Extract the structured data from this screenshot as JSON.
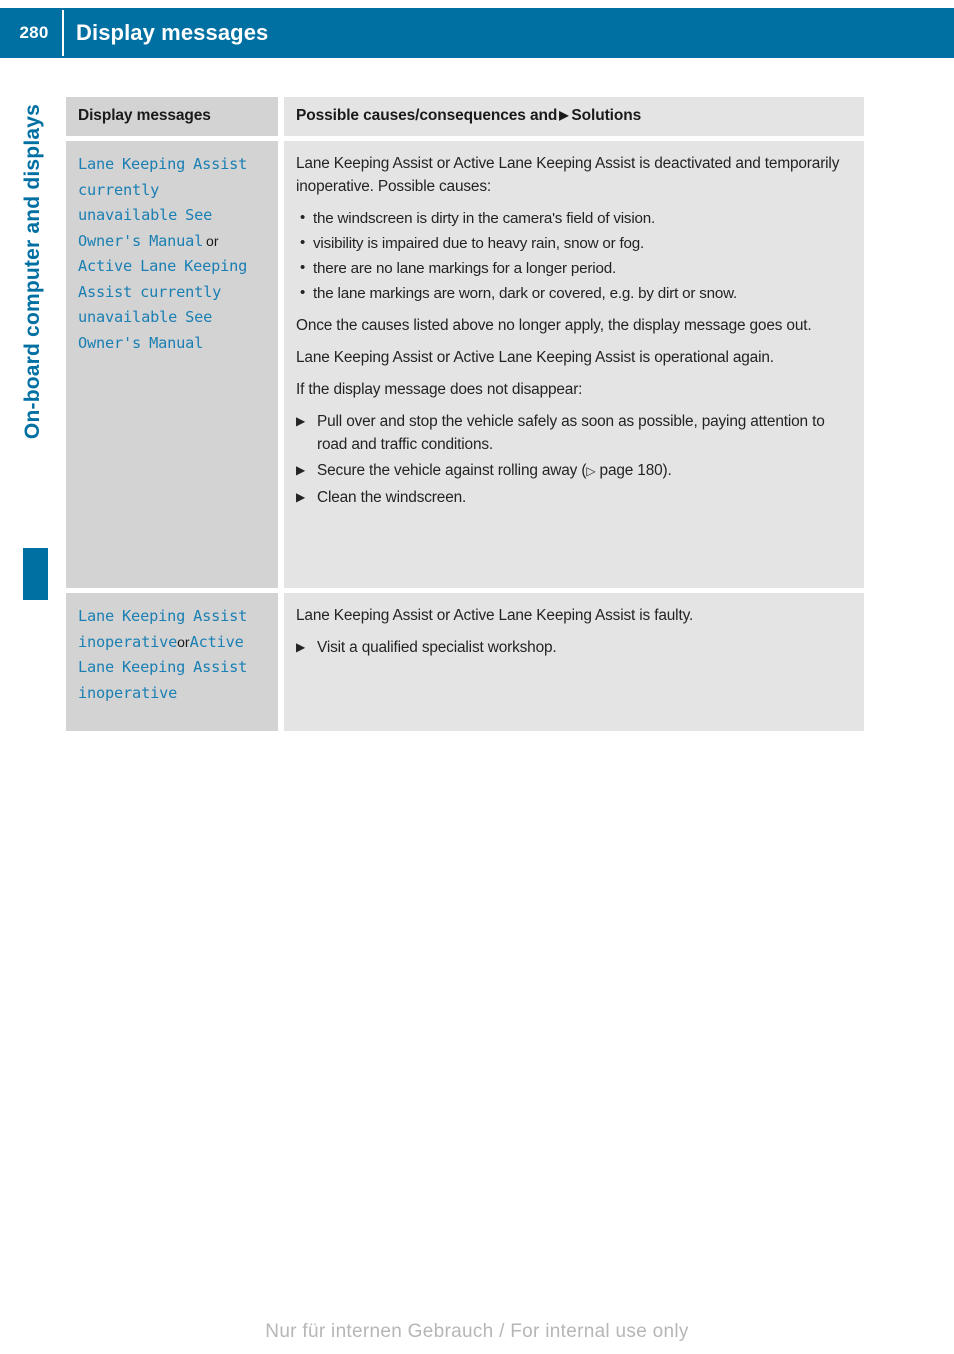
{
  "header": {
    "page_number": "280",
    "title": "Display messages"
  },
  "sidebar": {
    "chapter_label": "On-board computer and displays"
  },
  "table": {
    "columns": {
      "left_header": "Display messages",
      "right_header_before": "Possible causes/consequences and",
      "right_header_arrow": "▶",
      "right_header_after": "Solutions"
    },
    "rows": [
      {
        "message": {
          "part1": "Lane Keeping Assist currently unavailable See Owner's Manual",
          "conjunction": " or ",
          "part2": "Active Lane Keeping Assist currently unavailable See Owner's Manual"
        },
        "intro": "Lane Keeping Assist or Active Lane Keeping Assist is deactivated and temporarily inoperative. Possible causes:",
        "causes": [
          "the windscreen is dirty in the camera's field of vision.",
          "visibility is impaired due to heavy rain, snow or fog.",
          "there are no lane markings for a longer period.",
          "the lane markings are worn, dark or covered, e.g. by dirt or snow."
        ],
        "para_after_causes": "Once the causes listed above no longer apply, the display message goes out.",
        "para_operational": "Lane Keeping Assist or Active Lane Keeping Assist is operational again.",
        "para_if_not_disappear": "If the display message does not disappear:",
        "actions": [
          {
            "text_before": "Pull over and stop the vehicle safely as soon as possible, paying attention to road and traffic conditions.",
            "ref_glyph": "",
            "text_after": ""
          },
          {
            "text_before": "Secure the vehicle against rolling away (",
            "ref_glyph": "▷",
            "text_after": " page 180)."
          },
          {
            "text_before": "Clean the windscreen.",
            "ref_glyph": "",
            "text_after": ""
          }
        ]
      },
      {
        "message": {
          "part1": "Lane Keeping Assist inoperative",
          "conjunction": "or",
          "part2": "Active Lane Keeping Assist inoperative"
        },
        "intro": "Lane Keeping Assist or Active Lane Keeping Assist is faulty.",
        "causes": [],
        "actions": [
          {
            "text_before": "Visit a qualified specialist workshop.",
            "ref_glyph": "",
            "text_after": ""
          }
        ]
      }
    ]
  },
  "footer": {
    "watermark": "Nur für internen Gebrauch / For internal use only"
  },
  "colors": {
    "brand_blue": "#0070a3",
    "message_blue": "#1a7fb3",
    "header_cell_left": "#d3d3d3",
    "header_cell_right": "#e4e4e4"
  }
}
